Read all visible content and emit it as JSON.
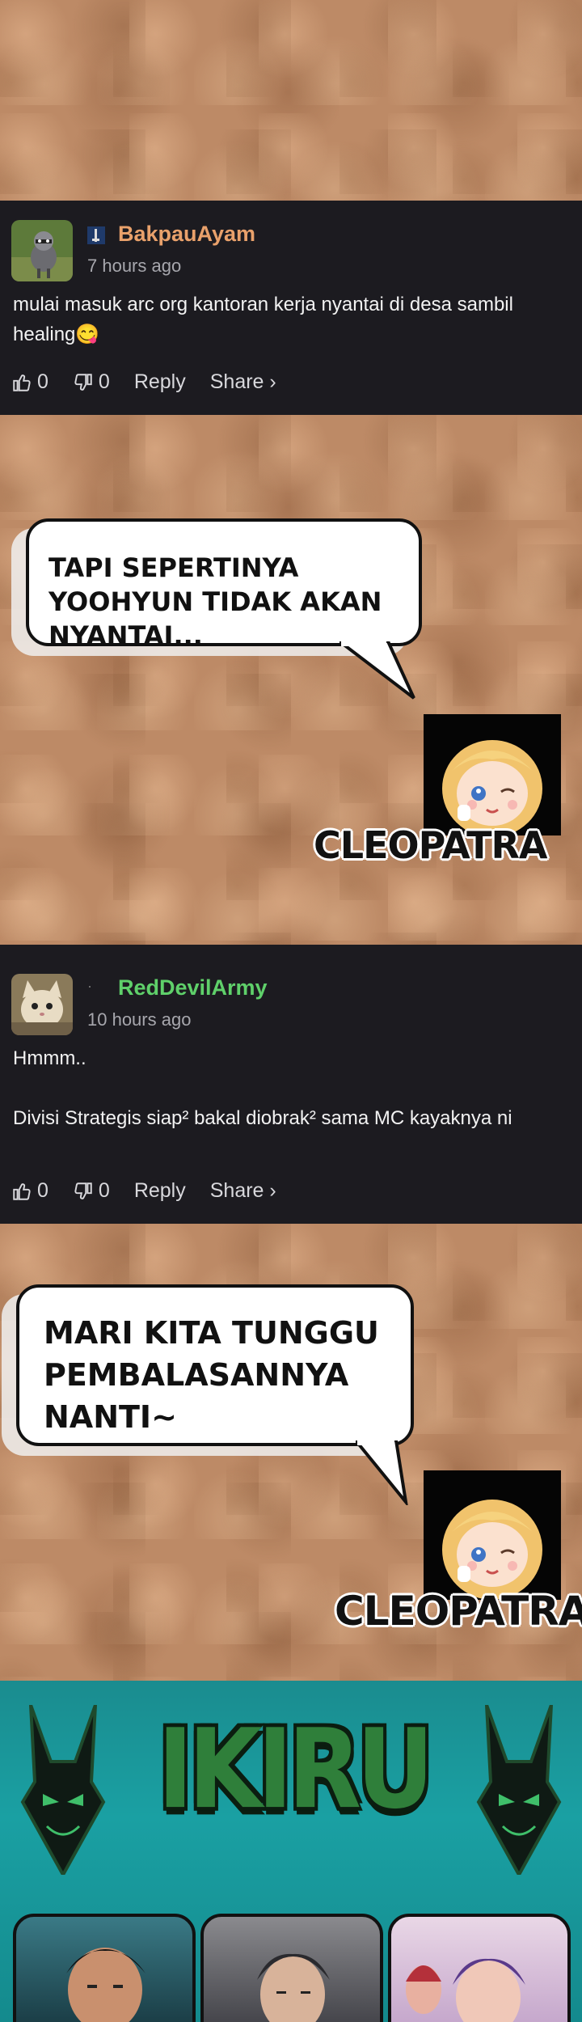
{
  "comments": [
    {
      "username": "BakpauAyam",
      "username_color": "#e9a16b",
      "flag": "🇮🇩",
      "time": "7 hours ago",
      "text": "mulai masuk arc org kantoran kerja nyantai di desa sambil healing😋",
      "likes": "0",
      "dislikes": "0",
      "reply": "Reply",
      "share": "Share ›",
      "avatar_icon": "raccoon-avatar"
    },
    {
      "username": "RedDevilArmy",
      "username_color": "#5fd06a",
      "flag": "·",
      "time": "10 hours ago",
      "text": "Hmmm..\n\nDivisi Strategis siap² bakal diobrak² sama MC kayaknya ni",
      "likes": "0",
      "dislikes": "0",
      "reply": "Reply",
      "share": "Share ›",
      "avatar_icon": "cat-avatar"
    }
  ],
  "panels": [
    {
      "bubble_text": "TAPI SEPERTINYA YOOHYUN TIDAK AKAN NYANTAI...",
      "caption": "CLEOPATRA"
    },
    {
      "bubble_text": "MARI KITA TUNGGU PEMBALASANNYA NANTI~",
      "caption": "CLEOPATRA"
    }
  ],
  "banner": {
    "logo": "IKIRU",
    "accent": "#1aa0a3",
    "icons": [
      "jackal-head-left-icon",
      "jackal-head-right-icon"
    ]
  }
}
